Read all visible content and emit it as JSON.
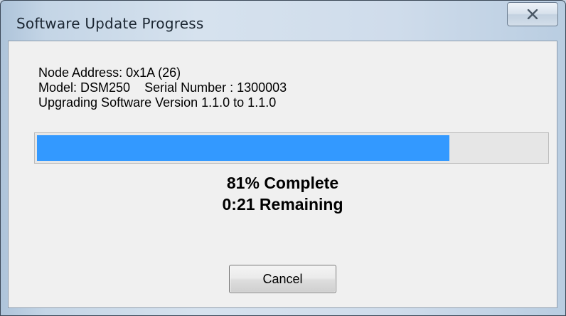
{
  "window": {
    "title": "Software Update Progress",
    "close_icon": "close-icon"
  },
  "info": {
    "node_address": "Node Address: 0x1A (26)",
    "model": "Model: DSM250",
    "serial_number": "Serial Number : 1300003",
    "upgrade": "Upgrading Software Version 1.1.0 to 1.1.0"
  },
  "progress": {
    "percent": 81,
    "complete_text": "81% Complete",
    "remaining_text": "0:21 Remaining",
    "fill_color": "#3399ff"
  },
  "buttons": {
    "cancel_label": "Cancel"
  }
}
